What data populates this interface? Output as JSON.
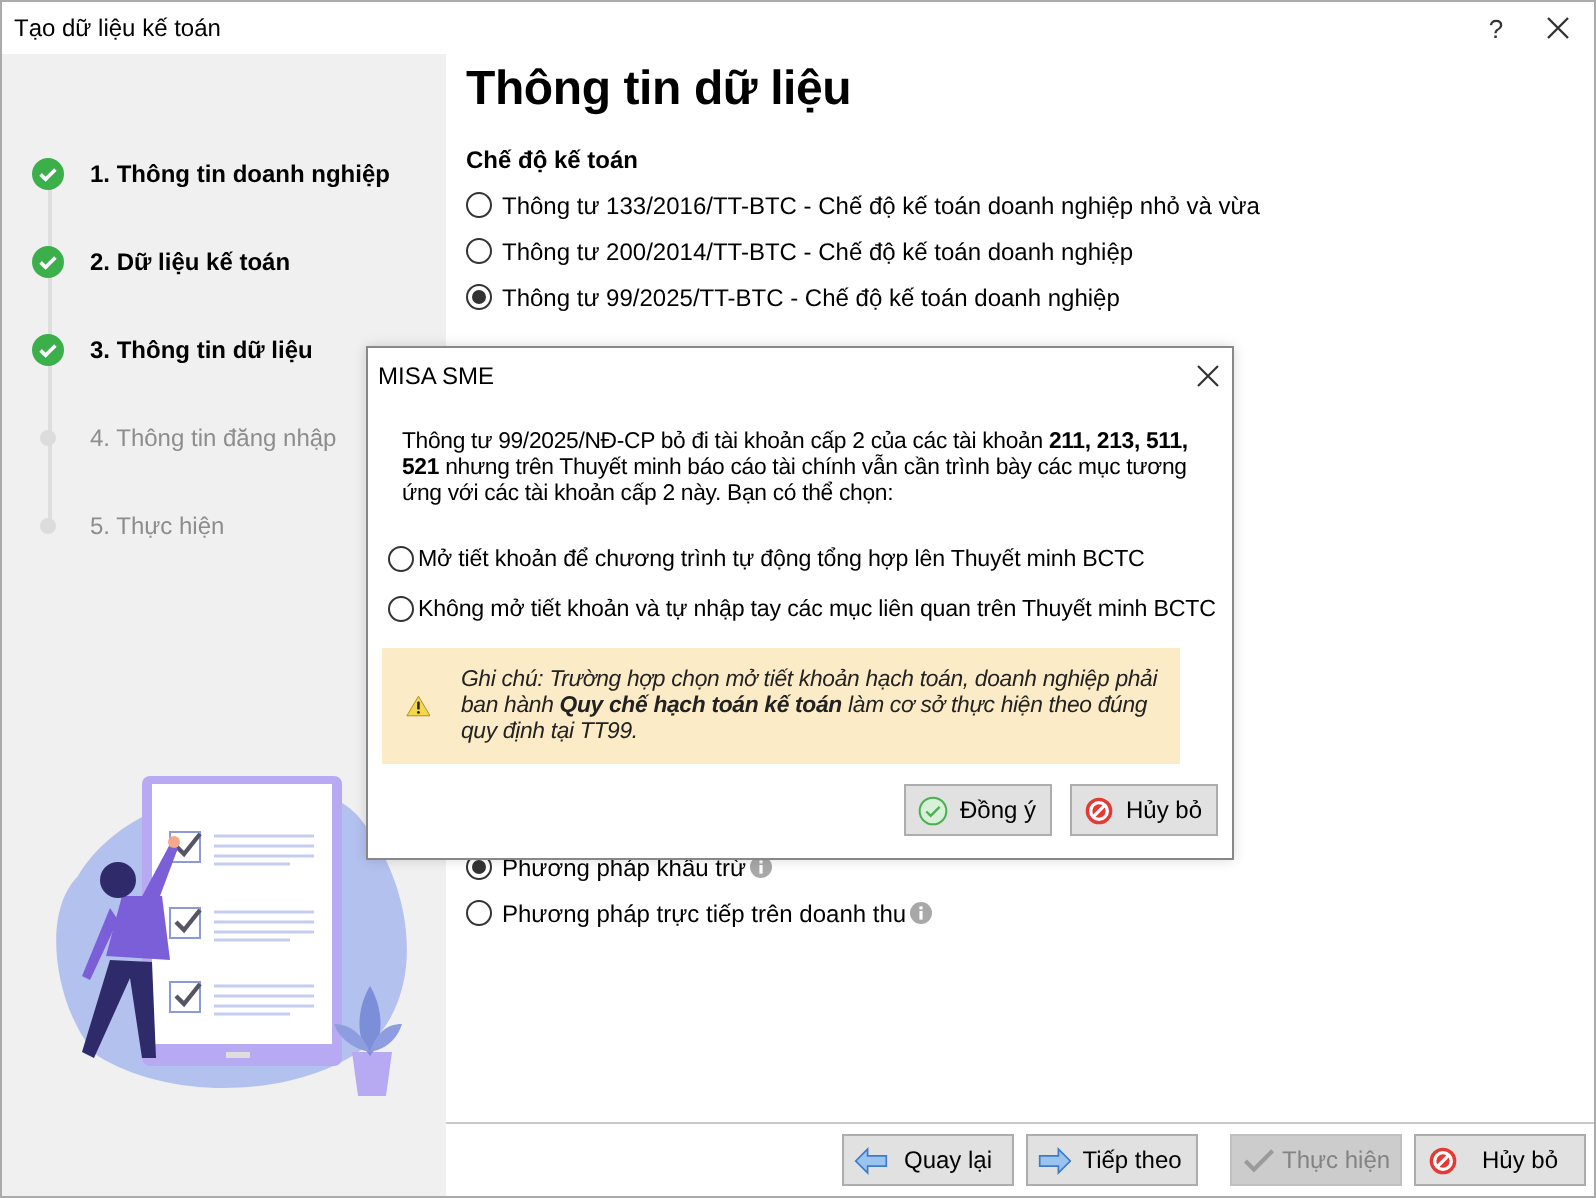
{
  "window": {
    "title": "Tạo dữ liệu kế toán",
    "help": "?"
  },
  "steps": [
    {
      "label": "1. Thông tin doanh nghiệp",
      "completed": true
    },
    {
      "label": "2. Dữ liệu kế toán",
      "completed": true
    },
    {
      "label": "3. Thông tin dữ liệu",
      "completed": true
    },
    {
      "label": "4. Thông tin đăng nhập",
      "completed": false
    },
    {
      "label": "5. Thực hiện",
      "completed": false
    }
  ],
  "page": {
    "heading": "Thông tin dữ liệu",
    "section_title": "Chế độ kế toán",
    "regimes": [
      {
        "label": "Thông tư 133/2016/TT-BTC - Chế độ kế toán doanh nghiệp nhỏ và vừa",
        "selected": false
      },
      {
        "label": "Thông tư 200/2014/TT-BTC - Chế độ kế toán doanh nghiệp",
        "selected": false
      },
      {
        "label": "Thông tư 99/2025/TT-BTC - Chế độ kế toán doanh nghiệp",
        "selected": true
      }
    ],
    "tax_methods": [
      {
        "label": "Phương pháp khấu trừ",
        "selected": true
      },
      {
        "label": "Phương pháp trực tiếp trên doanh thu",
        "selected": false
      }
    ]
  },
  "dialog": {
    "title": "MISA SME",
    "message": "Thông tư 99/2025/NĐ-CP bỏ đi tài khoản cấp 2 của các tài khoản **211, 213, 511, 521** nhưng trên Thuyết minh báo cáo tài chính vẫn cần trình bày các mục tương ứng với các tài khoản cấp 2 này. Bạn có thể chọn:",
    "options": [
      {
        "label": "Mở tiết khoản để chương trình tự động tổng hợp lên Thuyết minh BCTC",
        "selected": false
      },
      {
        "label": "Không mở tiết khoản và tự nhập tay các mục liên quan trên Thuyết minh BCTC",
        "selected": false
      }
    ],
    "note": "Ghi chú: Trường hợp chọn mở tiết khoản hạch toán, doanh nghiệp phải ban hành **Quy chế hạch toán kế toán** làm cơ sở thực hiện theo đúng quy định tại TT99.",
    "buttons": [
      {
        "label": "Đồng ý",
        "kind": "ok",
        "disabled": false
      },
      {
        "label": "Hủy bỏ",
        "kind": "cancel",
        "disabled": false
      }
    ]
  },
  "footer_buttons": [
    {
      "label": "Quay lại",
      "kind": "back",
      "disabled": false
    },
    {
      "label": "Tiếp theo",
      "kind": "next",
      "disabled": false
    },
    {
      "label": "Thực hiện",
      "kind": "finish",
      "disabled": true
    },
    {
      "label": "Hủy bỏ",
      "kind": "cancel",
      "disabled": false
    }
  ]
}
